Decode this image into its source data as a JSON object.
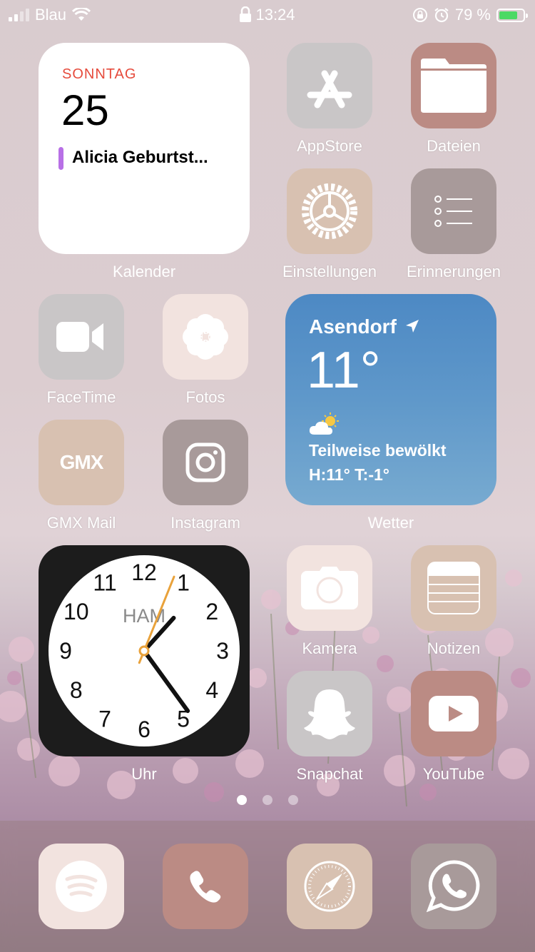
{
  "status": {
    "carrier": "Blau",
    "time": "13:24",
    "battery": "79 %",
    "battery_level": 0.79
  },
  "calendar_widget": {
    "day": "SONNTAG",
    "date": "25",
    "event": "Alicia Geburtst...",
    "label": "Kalender",
    "event_color": "#b870e6"
  },
  "weather_widget": {
    "city": "Asendorf",
    "temperature": "11°",
    "condition": "Teilweise bewölkt",
    "high_low": "H:11° T:-1°",
    "label": "Wetter"
  },
  "clock_widget": {
    "city": "HAM",
    "label": "Uhr",
    "numbers": [
      "12",
      "1",
      "2",
      "3",
      "4",
      "5",
      "6",
      "7",
      "8",
      "9",
      "10",
      "11"
    ],
    "time": "13:24"
  },
  "apps": {
    "appstore": "AppStore",
    "dateien": "Dateien",
    "einstellungen": "Einstellungen",
    "erinnerungen": "Erinnerungen",
    "facetime": "FaceTime",
    "fotos": "Fotos",
    "gmx": "GMX Mail",
    "gmx_logo": "GMX",
    "instagram": "Instagram",
    "kamera": "Kamera",
    "notizen": "Notizen",
    "snapchat": "Snapchat",
    "youtube": "YouTube"
  },
  "page_dots": {
    "count": 3,
    "active": 1
  },
  "dock": [
    "spotify-icon",
    "phone-icon",
    "safari-icon",
    "whatsapp-icon"
  ],
  "colors": {
    "grey": "#c9c6c7",
    "rose": "#bb8b84",
    "beige": "#d8c1b1",
    "taupe": "#a89a9a",
    "blush": "#f2e3df"
  }
}
